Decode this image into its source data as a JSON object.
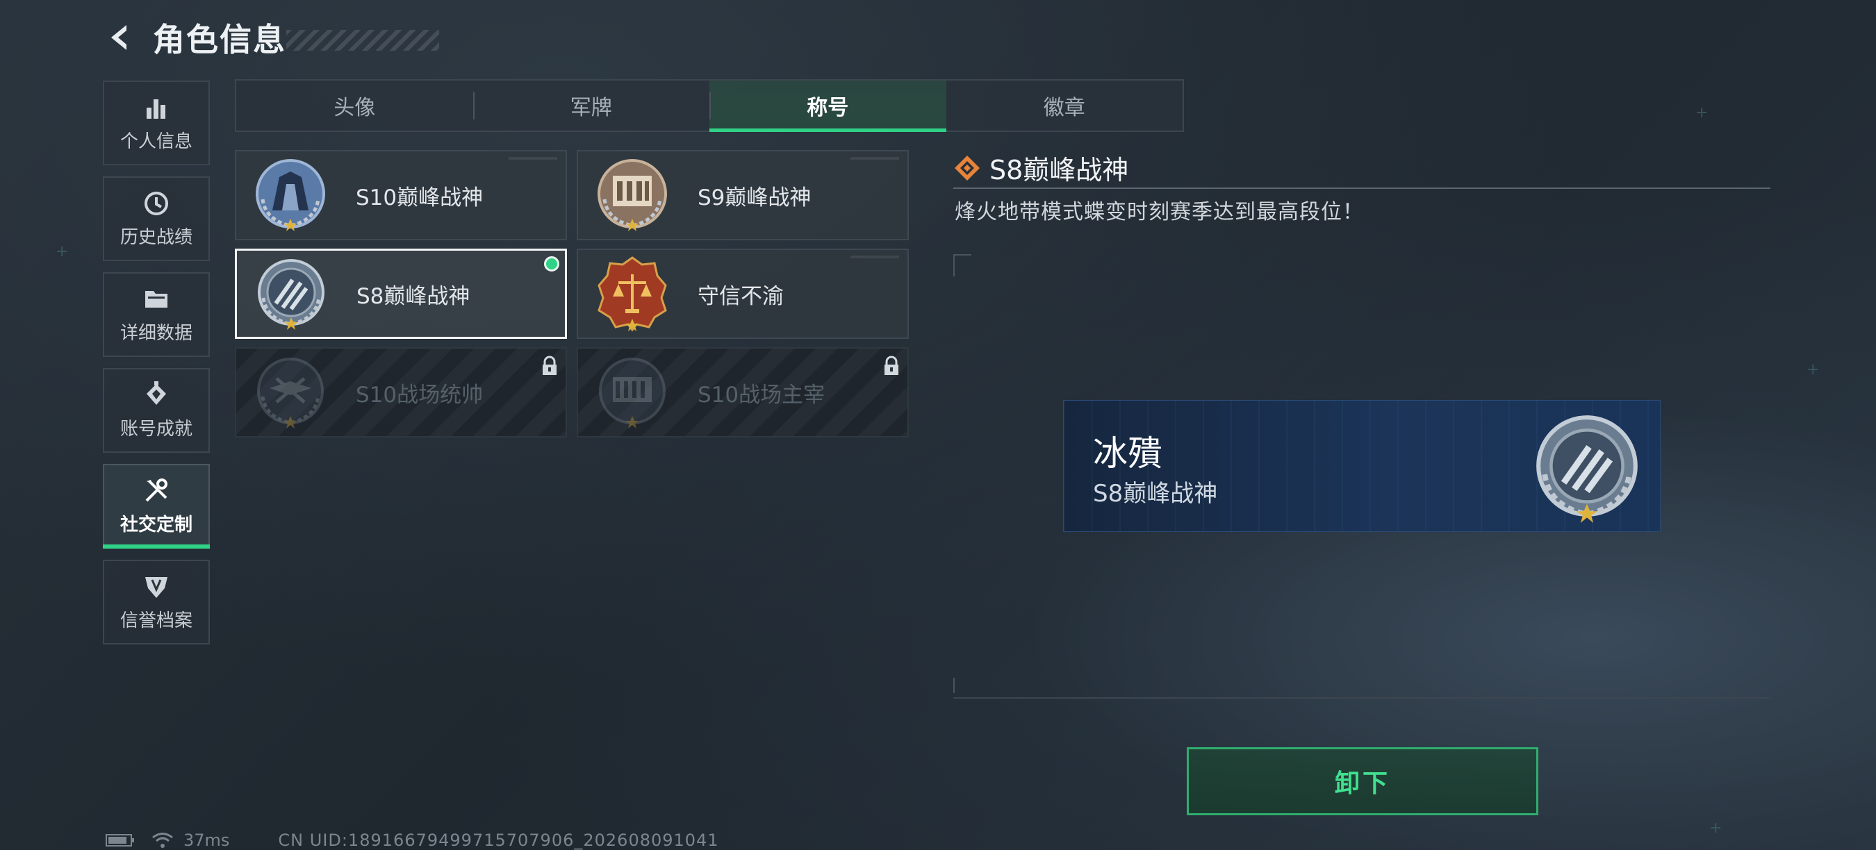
{
  "header": {
    "title": "角色信息",
    "back_icon": "back-arrow-icon"
  },
  "sidebar": {
    "items": [
      {
        "label": "个人信息",
        "icon": "bar-chart-icon",
        "active": false
      },
      {
        "label": "历史战绩",
        "icon": "history-clock-icon",
        "active": false
      },
      {
        "label": "详细数据",
        "icon": "folder-icon",
        "active": false
      },
      {
        "label": "账号成就",
        "icon": "achievement-icon",
        "active": false
      },
      {
        "label": "社交定制",
        "icon": "tools-icon",
        "active": true
      },
      {
        "label": "信誉档案",
        "icon": "credit-shield-icon",
        "active": false
      }
    ]
  },
  "tabs": [
    {
      "label": "头像",
      "active": false
    },
    {
      "label": "军牌",
      "active": false
    },
    {
      "label": "称号",
      "active": true
    },
    {
      "label": "徽章",
      "active": false
    }
  ],
  "titles": [
    {
      "name": "S10巅峰战神",
      "state": "normal",
      "emblem": "peak-warrior-s10-emblem-icon"
    },
    {
      "name": "S9巅峰战神",
      "state": "normal",
      "emblem": "peak-warrior-s9-emblem-icon"
    },
    {
      "name": "S8巅峰战神",
      "state": "selected",
      "emblem": "peak-warrior-s8-emblem-icon"
    },
    {
      "name": "守信不渝",
      "state": "normal",
      "emblem": "scales-emblem-icon"
    },
    {
      "name": "S10战场统帅",
      "state": "locked",
      "emblem": "battlefield-commander-emblem-icon"
    },
    {
      "name": "S10战场主宰",
      "state": "locked",
      "emblem": "battlefield-ruler-emblem-icon"
    }
  ],
  "detail": {
    "title": "S8巅峰战神",
    "description": "烽火地带模式蝶变时刻赛季达到最高段位！",
    "title_icon": "diamond-rank-icon"
  },
  "preview": {
    "player_name": "冰殨",
    "title": "S8巅峰战神"
  },
  "unequip_label": "卸下",
  "status": {
    "ping": "37ms",
    "uid": "CN UID:18916679499715707906_202608091041"
  },
  "colors": {
    "accent": "#2fd286",
    "selected_border": "#f1f3f5",
    "diamond": "#e8833a"
  }
}
